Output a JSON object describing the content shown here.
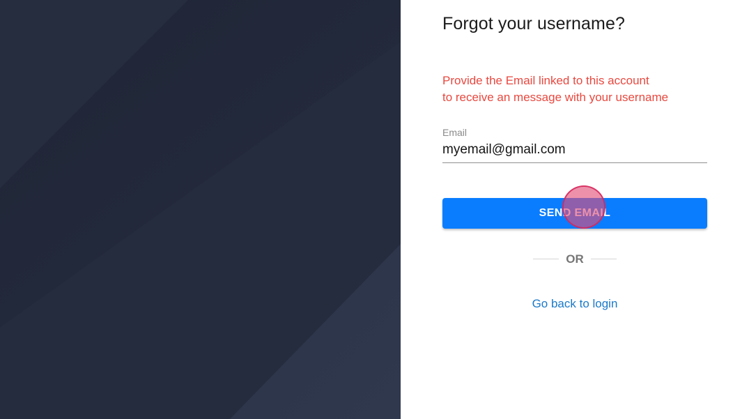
{
  "forgot": {
    "title": "Forgot your username?",
    "message_line1": "Provide the Email linked to this account",
    "message_line2": "to receive an message with your username",
    "email_label": "Email",
    "email_value": "myemail@gmail.com",
    "send_button_label": "SEND EMAIL",
    "divider_text": "OR",
    "back_link_label": "Go back to login"
  },
  "colors": {
    "background_panel": "#262d40",
    "message": "#e8483f",
    "primary_button": "#0a7dff",
    "link": "#1a79c9"
  }
}
